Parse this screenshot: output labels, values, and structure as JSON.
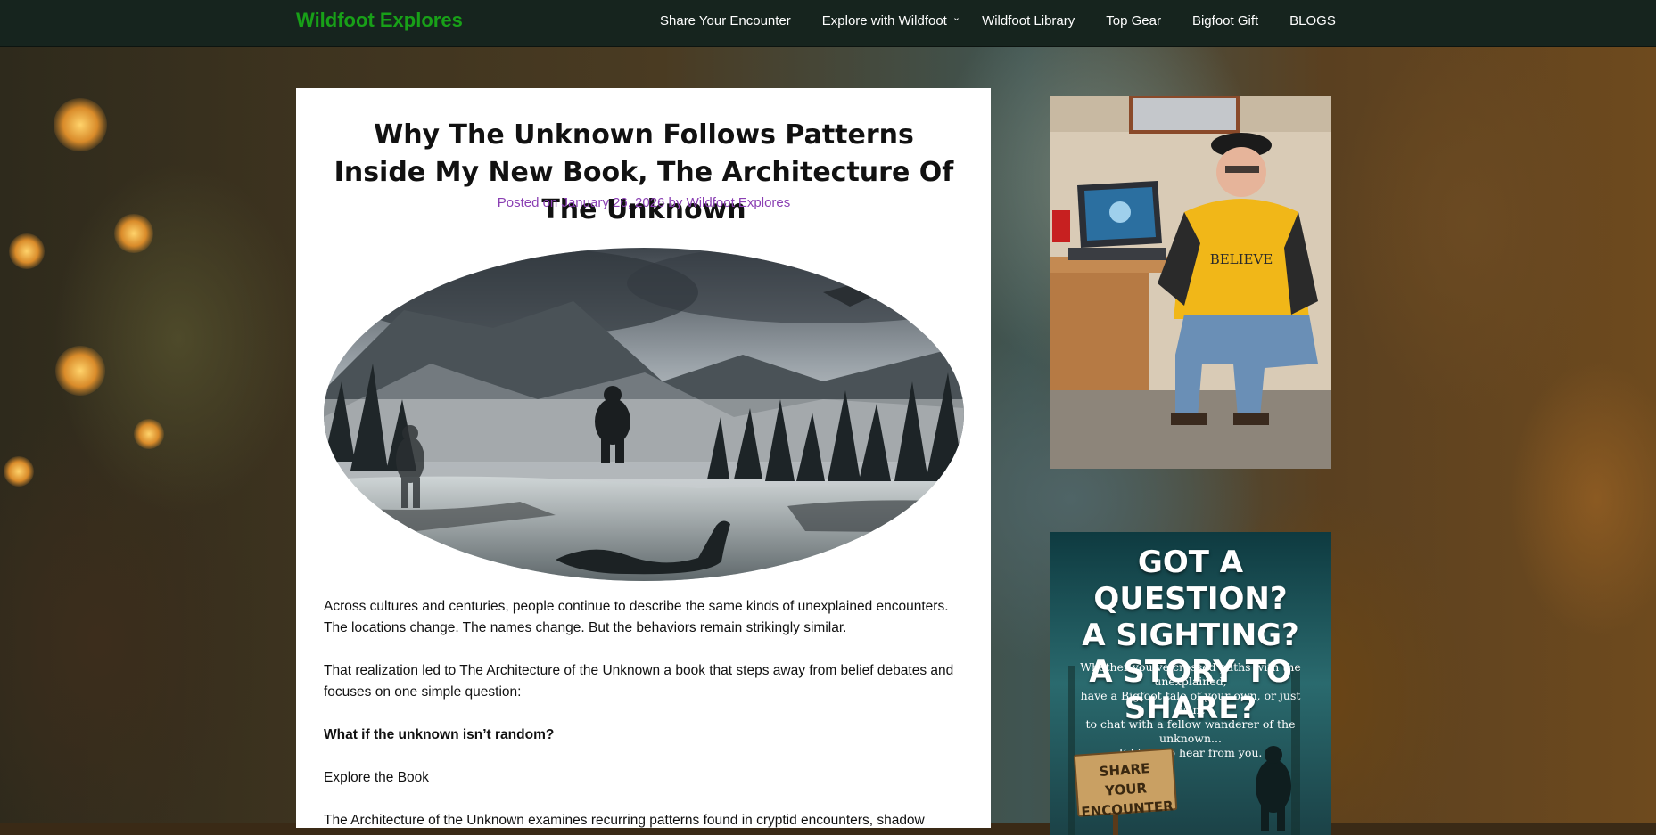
{
  "site": {
    "title": "Wildfoot Explores"
  },
  "nav": {
    "items": [
      {
        "label": "Share Your Encounter"
      },
      {
        "label": "Explore with Wildfoot",
        "has_dropdown": true
      },
      {
        "label": "Wildfoot Library"
      },
      {
        "label": "Top Gear"
      },
      {
        "label": "Bigfoot Gift"
      },
      {
        "label": "BLOGS"
      }
    ]
  },
  "article": {
    "title": "Why The Unknown Follows Patterns Inside My New Book, The Architecture Of The Unknown",
    "meta": {
      "posted_on": "Posted on",
      "date": "January 26, 2026",
      "by": "by",
      "author": "Wildfoot Explores"
    },
    "paragraphs": [
      "Across cultures and centuries, people continue to describe the same kinds of unexplained encounters. The locations change. The names change. But the behaviors remain strikingly similar.",
      "That realization led to The Architecture of the Unknown a book that steps away from belief debates and focuses on one simple question:",
      "What if the unknown isn’t random?",
      "Explore the Book",
      "The Architecture of the Unknown examines recurring patterns found in cryptid encounters, shadow"
    ]
  },
  "sidebar": {
    "promo": {
      "headline_lines": [
        "GOT A QUESTION?",
        "A SIGHTING?",
        "A STORY TO SHARE?"
      ],
      "subtext_lines": [
        "Whether you’ve crossed paths with the unexplained,",
        "have a Bigfoot tale of your own, or just want",
        "to chat with a fellow wanderer of the unknown...",
        "I’d love to hear from you."
      ],
      "sign_lines": [
        "SHARE YOUR",
        "ENCOUNTER"
      ]
    },
    "photo": {
      "sweatshirt_text": "BELIEVE"
    }
  },
  "colors": {
    "nav_bg": "#16241e",
    "site_title": "#18a018",
    "meta_link": "#8a3fb3",
    "card_bg": "#ffffff"
  }
}
